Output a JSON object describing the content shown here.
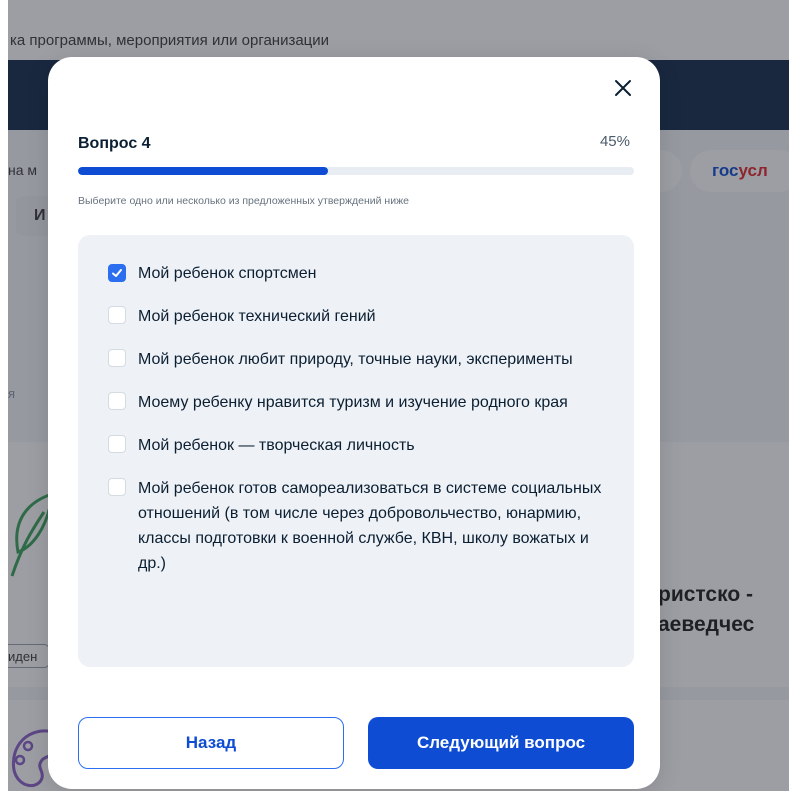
{
  "background": {
    "search_hint": "ка программы, мероприятия или организации",
    "chip_left": "на м",
    "chip_letter": "И",
    "gos_logo_blue": "гос",
    "gos_logo_red": "усл",
    "side_letter": "я",
    "card_title_line1": "ристско -",
    "card_title_line2": "аеведчес",
    "tag_text": "иден",
    "brand_color": "#0d4cd3",
    "nav_color": "#12284a"
  },
  "modal": {
    "close_icon": "close-icon",
    "question_title": "Вопрос 4",
    "progress_label": "45%",
    "progress_value": 0.45,
    "hint": "Выберите одно или несколько из предложенных утверждений ниже",
    "options": [
      {
        "label": "Мой ребенок спортсмен",
        "checked": true
      },
      {
        "label": "Мой ребенок технический гений",
        "checked": false
      },
      {
        "label": "Мой ребенок любит природу, точные науки, эксперименты",
        "checked": false
      },
      {
        "label": "Моему ребенку нравится туризм и изучение родного края",
        "checked": false
      },
      {
        "label": "Мой ребенок — творческая личность",
        "checked": false
      },
      {
        "label": "Мой ребенок готов самореализоваться в системе социальных отношений (в том числе через добровольчество, юнармию, классы подготовки к военной службе, КВН, школу вожатых и др.)",
        "checked": false
      }
    ],
    "back_label": "Назад",
    "next_label": "Следующий вопрос",
    "accent_color": "#0d4cd3"
  }
}
